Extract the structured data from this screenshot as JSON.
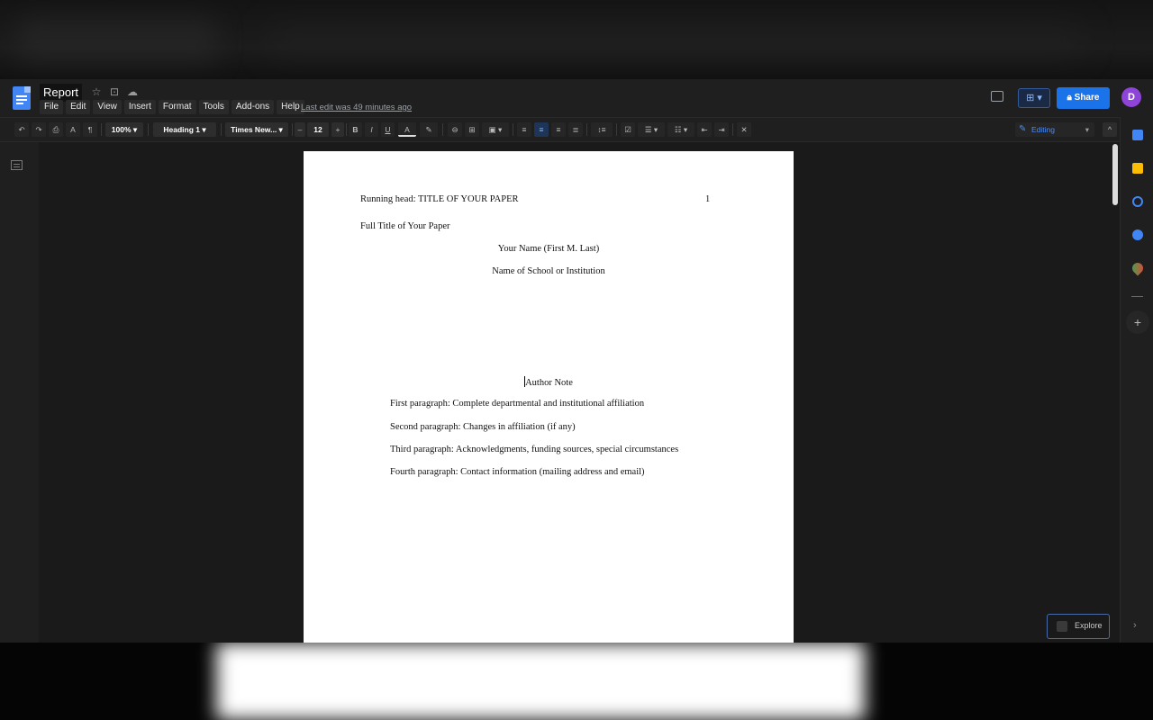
{
  "document": {
    "title": "Report",
    "last_edit": "Last edit was 49 minutes ago"
  },
  "menu": [
    "File",
    "Edit",
    "View",
    "Insert",
    "Format",
    "Tools",
    "Add-ons",
    "Help"
  ],
  "header_actions": {
    "share_label": "Share",
    "avatar_letter": "D"
  },
  "toolbar": {
    "zoom": "100%",
    "style": "Heading 1",
    "font": "Times New...",
    "font_size": "12",
    "minus": "–",
    "plus": "+",
    "bold": "B",
    "italic": "I",
    "underline": "U",
    "text_color": "A",
    "mode": "Editing",
    "collapse": "^"
  },
  "page": {
    "running_head": "Running head: TITLE OF YOUR PAPER",
    "page_number": "1",
    "full_title": "Full Title of Your Paper",
    "author_name": "Your Name (First M. Last)",
    "institution": "Name of School or Institution",
    "author_note": "Author Note",
    "paragraphs": [
      "First paragraph: Complete departmental and institutional affiliation",
      "Second paragraph: Changes in affiliation (if any)",
      "Third paragraph: Acknowledgments, funding sources, special circumstances",
      "Fourth paragraph: Contact information (mailing address and email)"
    ]
  },
  "explore_label": "Explore",
  "colors": {
    "accent": "#1a73e8",
    "avatar": "#8e44d8",
    "active_tool": "#8ab4f8"
  },
  "side_icons": [
    "calendar-icon",
    "keep-icon",
    "tasks-icon",
    "contacts-icon",
    "maps-icon"
  ]
}
